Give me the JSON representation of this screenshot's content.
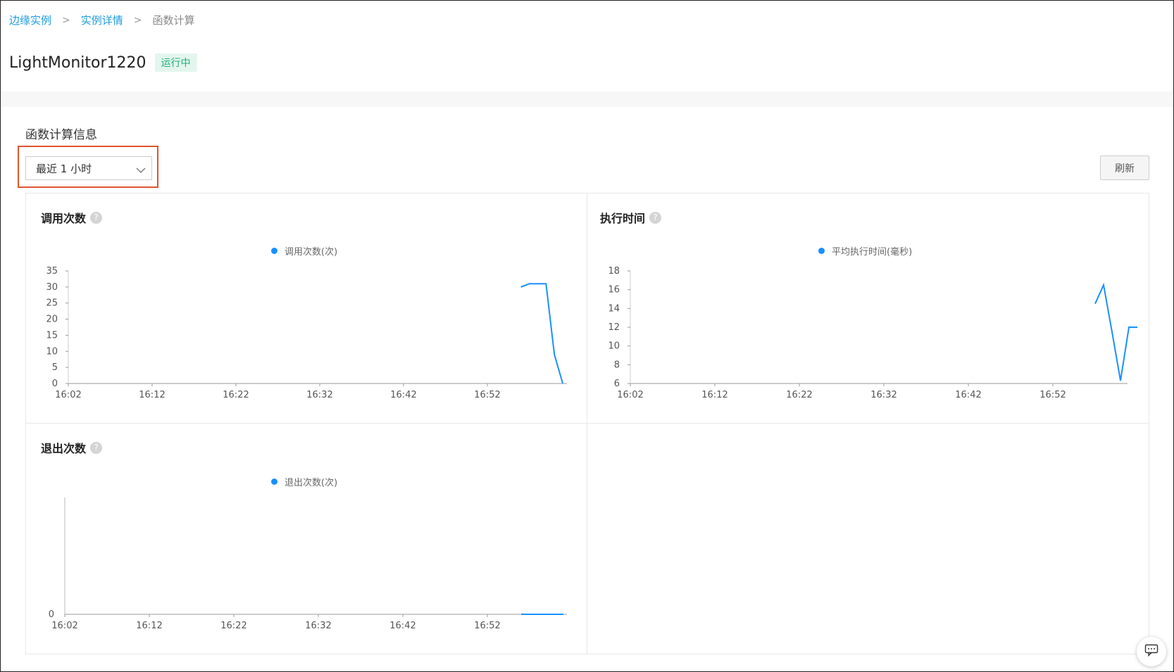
{
  "breadcrumb": {
    "items": [
      {
        "label": "边缘实例",
        "link": true
      },
      {
        "label": "实例详情",
        "link": true
      },
      {
        "label": "函数计算",
        "link": false
      }
    ],
    "separator": ">"
  },
  "instance": {
    "name": "LightMonitor1220",
    "status": "运行中"
  },
  "section": {
    "title": "函数计算信息",
    "time_range": {
      "selected": "最近 1 小时"
    },
    "refresh_label": "刷新"
  },
  "panels": {
    "invocations": {
      "title": "调用次数",
      "help": "?"
    },
    "duration": {
      "title": "执行时间",
      "help": "?"
    },
    "exits": {
      "title": "退出次数",
      "help": "?"
    }
  },
  "colors": {
    "accent": "#1c9ddb",
    "series": "#1890ff",
    "status_bg": "#e3f6ee",
    "status_text": "#21b07a",
    "highlight": "#e0542e"
  },
  "icons": {
    "help": "question-circle-icon",
    "dropdown": "chevron-down-icon",
    "chat": "chat-icon"
  },
  "chart_data": [
    {
      "type": "line",
      "title": "调用次数",
      "xlabel": "",
      "ylabel": "",
      "x_ticks": [
        "16:02",
        "16:12",
        "16:22",
        "16:32",
        "16:42",
        "16:52"
      ],
      "y_ticks": [
        0,
        5,
        10,
        15,
        20,
        25,
        30,
        35
      ],
      "ylim": [
        0,
        35
      ],
      "legend": "top-center",
      "grid": false,
      "series": [
        {
          "name": "调用次数(次)",
          "x": [
            "16:56",
            "16:57",
            "16:58",
            "16:59",
            "17:00",
            "17:01"
          ],
          "y": [
            30,
            31,
            31,
            31,
            9,
            0
          ]
        }
      ]
    },
    {
      "type": "line",
      "title": "执行时间",
      "xlabel": "",
      "ylabel": "",
      "x_ticks": [
        "16:02",
        "16:12",
        "16:22",
        "16:32",
        "16:42",
        "16:52"
      ],
      "y_ticks": [
        6,
        8,
        10,
        12,
        14,
        16,
        18
      ],
      "ylim": [
        6,
        18
      ],
      "legend": "top-center",
      "grid": false,
      "series": [
        {
          "name": "平均执行时间(毫秒)",
          "x": [
            "16:57",
            "16:58",
            "16:59",
            "17:00",
            "17:01",
            "17:02"
          ],
          "y": [
            14.5,
            16.5,
            11.5,
            6.3,
            12,
            12
          ]
        }
      ]
    },
    {
      "type": "line",
      "title": "退出次数",
      "xlabel": "",
      "ylabel": "",
      "x_ticks": [
        "16:02",
        "16:12",
        "16:22",
        "16:32",
        "16:42",
        "16:52"
      ],
      "y_ticks": [
        0
      ],
      "ylim": [
        0,
        1
      ],
      "legend": "top-center",
      "grid": false,
      "series": [
        {
          "name": "退出次数(次)",
          "x": [
            "16:56",
            "16:57",
            "16:58",
            "16:59",
            "17:00",
            "17:01"
          ],
          "y": [
            0,
            0,
            0,
            0,
            0,
            0
          ]
        }
      ]
    }
  ]
}
